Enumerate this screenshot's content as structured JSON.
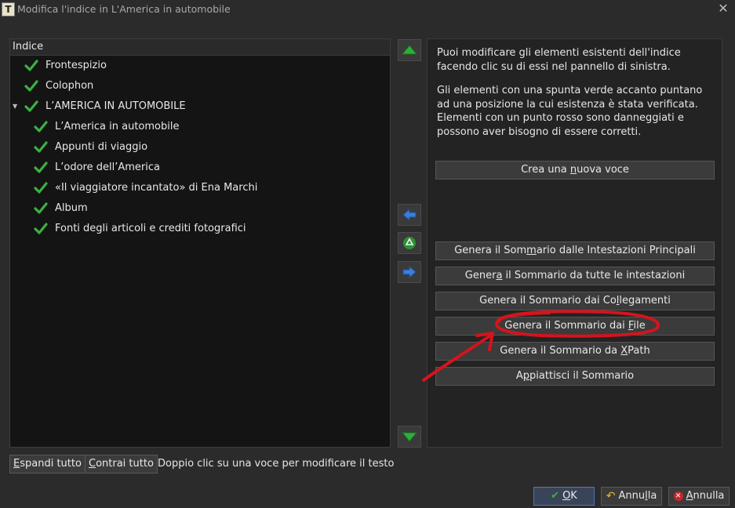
{
  "window": {
    "title": "Modifica l'indice in L'America in automobile",
    "app_icon_letter": "T"
  },
  "tree": {
    "header": "Indice",
    "items": [
      {
        "label": "Frontespizio",
        "level": 0,
        "status": "check"
      },
      {
        "label": "Colophon",
        "level": 0,
        "status": "check"
      },
      {
        "label": "L’AMERICA IN AUTOMOBILE",
        "level": 0,
        "status": "check",
        "expanded": true
      },
      {
        "label": "L’America in automobile",
        "level": 1,
        "status": "check"
      },
      {
        "label": "Appunti di viaggio",
        "level": 1,
        "status": "check"
      },
      {
        "label": "L’odore dell’America",
        "level": 1,
        "status": "check"
      },
      {
        "label": "«Il viaggiatore incantato» di Ena Marchi",
        "level": 1,
        "status": "check"
      },
      {
        "label": "Album",
        "level": 1,
        "status": "check"
      },
      {
        "label": "Fonti degli articoli e crediti fotografici",
        "level": 1,
        "status": "check"
      }
    ]
  },
  "right": {
    "desc1": "Puoi modificare gli elementi esistenti dell'indice facendo clic su di essi nel pannello di sinistra.",
    "desc2": "Gli elementi con una spunta verde accanto puntano ad una posizione la cui esistenza è stata verificata. Elementi con un punto rosso sono danneggiati e possono aver bisogno di essere corretti.",
    "new_entry": {
      "pre": "Crea una ",
      "mn": "n",
      "post": "uova voce"
    },
    "gen_headings_main": {
      "pre": "Genera il Som",
      "mn": "m",
      "post": "ario dalle Intestazioni Principali"
    },
    "gen_all_headings": {
      "pre": "Gener",
      "mn": "a",
      "post": " il Sommario da tutte le intestazioni"
    },
    "gen_links": {
      "pre": "Genera il Sommario dai Co",
      "mn": "l",
      "post": "legamenti"
    },
    "gen_files": {
      "pre": "Genera il Sommario dai ",
      "mn": "F",
      "post": "ile"
    },
    "gen_xpath": {
      "pre": "Genera il Sommario da ",
      "mn": "X",
      "post": "Path"
    },
    "flatten": {
      "pre": "A",
      "mn": "p",
      "post": "piattisci il Sommario"
    }
  },
  "bottom": {
    "expand_all": {
      "pre": "",
      "mn": "E",
      "post": "spandi tutto"
    },
    "collapse_all": {
      "pre": "",
      "mn": "C",
      "post": "ontrai tutto"
    },
    "hint": "Doppio clic su una voce per modificare il testo",
    "ok": {
      "pre": "",
      "mn": "O",
      "post": "K"
    },
    "undo": {
      "pre": "Annu",
      "mn": "l",
      "post": "la"
    },
    "cancel": {
      "pre": "",
      "mn": "A",
      "post": "nnulla"
    }
  },
  "colors": {
    "check_green": "#3cb043",
    "annotation_red": "#d4141c",
    "arrow_green": "#2fae3b",
    "arrow_blue": "#3a7fd8"
  }
}
